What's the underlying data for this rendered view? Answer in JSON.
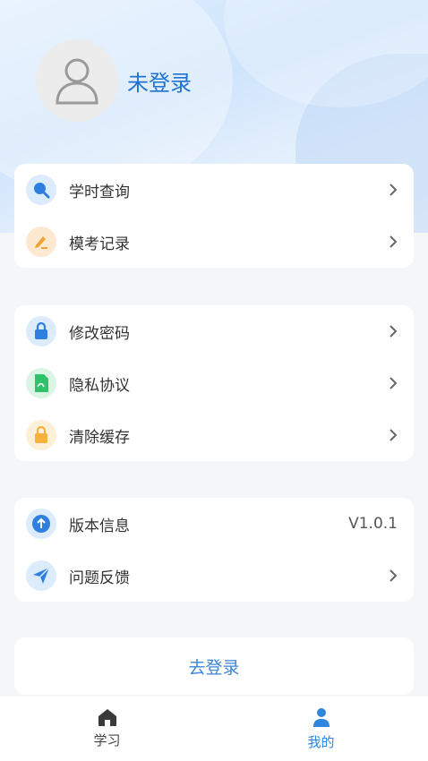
{
  "profile": {
    "username": "未登录",
    "avatar_icon": "user-avatar-icon"
  },
  "group1": [
    {
      "label": "学时查询",
      "icon": "search-icon",
      "icon_bg": "#dcecfd",
      "icon_color": "#2f7fe0"
    },
    {
      "label": "模考记录",
      "icon": "pencil-icon",
      "icon_bg": "#fde9cf",
      "icon_color": "#f0a232"
    }
  ],
  "group2": [
    {
      "label": "修改密码",
      "icon": "lock-icon",
      "icon_bg": "#dcecfd",
      "icon_color": "#2f7fe0"
    },
    {
      "label": "隐私协议",
      "icon": "document-icon",
      "icon_bg": "#daf5e3",
      "icon_color": "#2fc26a"
    },
    {
      "label": "清除缓存",
      "icon": "lock-icon",
      "icon_bg": "#fdf0d8",
      "icon_color": "#f6b23a"
    }
  ],
  "group3": [
    {
      "label": "版本信息",
      "value": "V1.0.1",
      "icon": "upload-icon",
      "icon_bg": "#dcecfd",
      "icon_color": "#2f7fe0"
    },
    {
      "label": "问题反馈",
      "icon": "send-icon",
      "icon_bg": "#dcecfd",
      "icon_color": "#2f7fe0"
    }
  ],
  "login_button": "去登录",
  "tabs": [
    {
      "label": "学习",
      "icon": "home-icon",
      "active": false
    },
    {
      "label": "我的",
      "icon": "person-icon",
      "active": true
    }
  ],
  "colors": {
    "accent": "#2e86de",
    "username": "#1e73d2"
  }
}
